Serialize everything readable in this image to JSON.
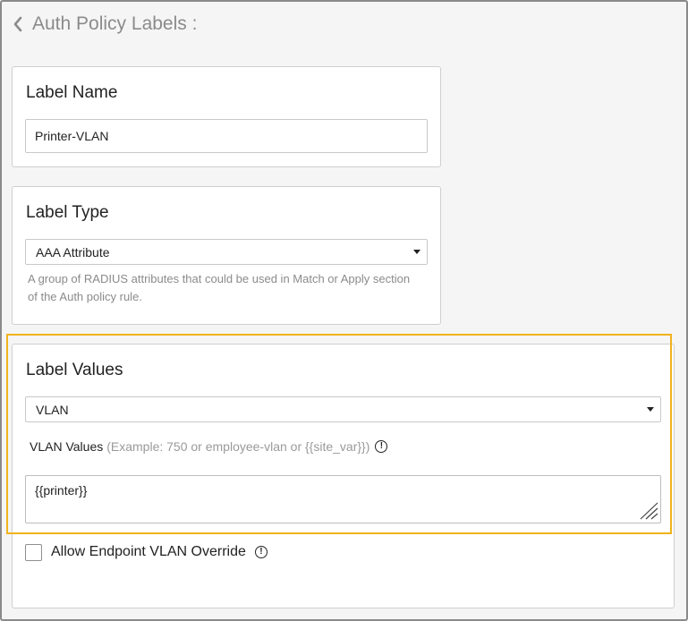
{
  "header": {
    "title": "Auth Policy Labels :"
  },
  "label_name": {
    "title": "Label Name",
    "value": "Printer-VLAN"
  },
  "label_type": {
    "title": "Label Type",
    "selected": "AAA Attribute",
    "help": "A group of RADIUS attributes that could be used in Match or Apply section of the Auth policy rule."
  },
  "label_values": {
    "title": "Label Values",
    "selected": "VLAN",
    "values_label": "VLAN Values",
    "values_example": "(Example: 750 or employee-vlan or {{site_var}})",
    "values_text": "{{printer}}",
    "override_label": "Allow Endpoint VLAN Override",
    "override_checked": false
  },
  "colors": {
    "highlight": "#f0b31d",
    "muted_text": "#8b8b8b"
  }
}
